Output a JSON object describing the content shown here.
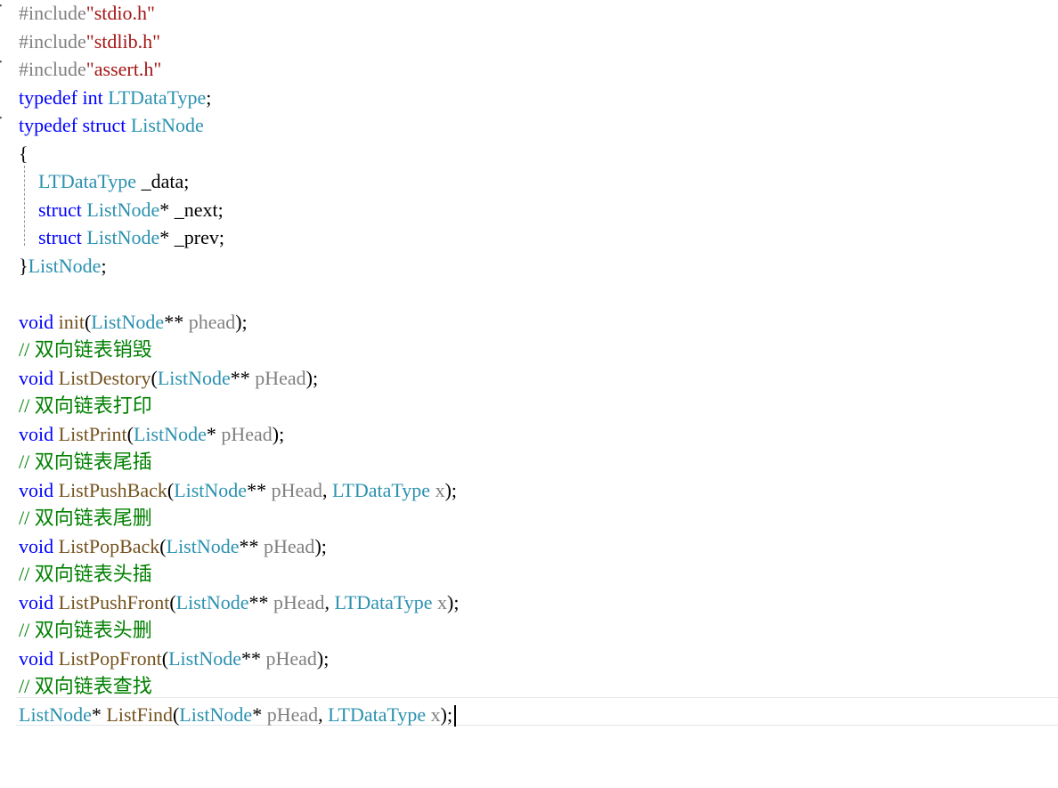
{
  "editor": {
    "lines": [
      {
        "fold": true,
        "tokens": [
          {
            "t": "#include",
            "k": "pp"
          },
          {
            "t": "\"stdio.h\"",
            "k": "str"
          }
        ]
      },
      {
        "fold": false,
        "tokens": [
          {
            "t": "#include",
            "k": "pp"
          },
          {
            "t": "\"stdlib.h\"",
            "k": "str"
          }
        ]
      },
      {
        "fold": true,
        "tokens": [
          {
            "t": "#include",
            "k": "pp"
          },
          {
            "t": "\"assert.h\"",
            "k": "str"
          }
        ]
      },
      {
        "fold": false,
        "tokens": [
          {
            "t": "typedef",
            "k": "kw"
          },
          {
            "t": " ",
            "k": "plain"
          },
          {
            "t": "int",
            "k": "kw"
          },
          {
            "t": " ",
            "k": "plain"
          },
          {
            "t": "LTDataType",
            "k": "type"
          },
          {
            "t": ";",
            "k": "plain"
          }
        ]
      },
      {
        "fold": true,
        "tokens": [
          {
            "t": "typedef",
            "k": "kw"
          },
          {
            "t": " ",
            "k": "plain"
          },
          {
            "t": "struct",
            "k": "kw"
          },
          {
            "t": " ",
            "k": "plain"
          },
          {
            "t": "ListNode",
            "k": "type"
          }
        ]
      },
      {
        "fold": false,
        "tokens": [
          {
            "t": "{",
            "k": "plain"
          }
        ]
      },
      {
        "fold": false,
        "tokens": [
          {
            "t": "    ",
            "k": "plain"
          },
          {
            "t": "LTDataType",
            "k": "type"
          },
          {
            "t": " _data;",
            "k": "plain"
          }
        ]
      },
      {
        "fold": false,
        "tokens": [
          {
            "t": "    ",
            "k": "plain"
          },
          {
            "t": "struct",
            "k": "kw"
          },
          {
            "t": " ",
            "k": "plain"
          },
          {
            "t": "ListNode",
            "k": "type"
          },
          {
            "t": "* _next;",
            "k": "plain"
          }
        ]
      },
      {
        "fold": false,
        "tokens": [
          {
            "t": "    ",
            "k": "plain"
          },
          {
            "t": "struct",
            "k": "kw"
          },
          {
            "t": " ",
            "k": "plain"
          },
          {
            "t": "ListNode",
            "k": "type"
          },
          {
            "t": "* _prev;",
            "k": "plain"
          }
        ]
      },
      {
        "fold": false,
        "tokens": [
          {
            "t": "}",
            "k": "plain"
          },
          {
            "t": "ListNode",
            "k": "type"
          },
          {
            "t": ";",
            "k": "plain"
          }
        ]
      },
      {
        "fold": false,
        "tokens": []
      },
      {
        "fold": false,
        "tokens": [
          {
            "t": "void",
            "k": "kw"
          },
          {
            "t": " ",
            "k": "plain"
          },
          {
            "t": "init",
            "k": "func"
          },
          {
            "t": "(",
            "k": "plain"
          },
          {
            "t": "ListNode",
            "k": "type"
          },
          {
            "t": "** ",
            "k": "plain"
          },
          {
            "t": "phead",
            "k": "param"
          },
          {
            "t": ");",
            "k": "plain"
          }
        ]
      },
      {
        "fold": false,
        "tokens": [
          {
            "t": "// 双向链表销毁",
            "k": "comment"
          }
        ]
      },
      {
        "fold": false,
        "tokens": [
          {
            "t": "void",
            "k": "kw"
          },
          {
            "t": " ",
            "k": "plain"
          },
          {
            "t": "ListDestory",
            "k": "func"
          },
          {
            "t": "(",
            "k": "plain"
          },
          {
            "t": "ListNode",
            "k": "type"
          },
          {
            "t": "** ",
            "k": "plain"
          },
          {
            "t": "pHead",
            "k": "param"
          },
          {
            "t": ");",
            "k": "plain"
          }
        ]
      },
      {
        "fold": false,
        "tokens": [
          {
            "t": "// 双向链表打印",
            "k": "comment"
          }
        ]
      },
      {
        "fold": false,
        "tokens": [
          {
            "t": "void",
            "k": "kw"
          },
          {
            "t": " ",
            "k": "plain"
          },
          {
            "t": "ListPrint",
            "k": "func"
          },
          {
            "t": "(",
            "k": "plain"
          },
          {
            "t": "ListNode",
            "k": "type"
          },
          {
            "t": "* ",
            "k": "plain"
          },
          {
            "t": "pHead",
            "k": "param"
          },
          {
            "t": ");",
            "k": "plain"
          }
        ]
      },
      {
        "fold": false,
        "tokens": [
          {
            "t": "// 双向链表尾插",
            "k": "comment"
          }
        ]
      },
      {
        "fold": false,
        "tokens": [
          {
            "t": "void",
            "k": "kw"
          },
          {
            "t": " ",
            "k": "plain"
          },
          {
            "t": "ListPushBack",
            "k": "func"
          },
          {
            "t": "(",
            "k": "plain"
          },
          {
            "t": "ListNode",
            "k": "type"
          },
          {
            "t": "** ",
            "k": "plain"
          },
          {
            "t": "pHead",
            "k": "param"
          },
          {
            "t": ", ",
            "k": "plain"
          },
          {
            "t": "LTDataType",
            "k": "type"
          },
          {
            "t": " ",
            "k": "plain"
          },
          {
            "t": "x",
            "k": "param"
          },
          {
            "t": ");",
            "k": "plain"
          }
        ]
      },
      {
        "fold": false,
        "tokens": [
          {
            "t": "// 双向链表尾删",
            "k": "comment"
          }
        ]
      },
      {
        "fold": false,
        "tokens": [
          {
            "t": "void",
            "k": "kw"
          },
          {
            "t": " ",
            "k": "plain"
          },
          {
            "t": "ListPopBack",
            "k": "func"
          },
          {
            "t": "(",
            "k": "plain"
          },
          {
            "t": "ListNode",
            "k": "type"
          },
          {
            "t": "** ",
            "k": "plain"
          },
          {
            "t": "pHead",
            "k": "param"
          },
          {
            "t": ");",
            "k": "plain"
          }
        ]
      },
      {
        "fold": false,
        "tokens": [
          {
            "t": "// 双向链表头插",
            "k": "comment"
          }
        ]
      },
      {
        "fold": false,
        "tokens": [
          {
            "t": "void",
            "k": "kw"
          },
          {
            "t": " ",
            "k": "plain"
          },
          {
            "t": "ListPushFront",
            "k": "func"
          },
          {
            "t": "(",
            "k": "plain"
          },
          {
            "t": "ListNode",
            "k": "type"
          },
          {
            "t": "** ",
            "k": "plain"
          },
          {
            "t": "pHead",
            "k": "param"
          },
          {
            "t": ", ",
            "k": "plain"
          },
          {
            "t": "LTDataType",
            "k": "type"
          },
          {
            "t": " ",
            "k": "plain"
          },
          {
            "t": "x",
            "k": "param"
          },
          {
            "t": ");",
            "k": "plain"
          }
        ]
      },
      {
        "fold": false,
        "tokens": [
          {
            "t": "// 双向链表头删",
            "k": "comment"
          }
        ]
      },
      {
        "fold": false,
        "tokens": [
          {
            "t": "void",
            "k": "kw"
          },
          {
            "t": " ",
            "k": "plain"
          },
          {
            "t": "ListPopFront",
            "k": "func"
          },
          {
            "t": "(",
            "k": "plain"
          },
          {
            "t": "ListNode",
            "k": "type"
          },
          {
            "t": "** ",
            "k": "plain"
          },
          {
            "t": "pHead",
            "k": "param"
          },
          {
            "t": ");",
            "k": "plain"
          }
        ]
      },
      {
        "fold": false,
        "tokens": [
          {
            "t": "// 双向链表查找",
            "k": "comment"
          }
        ]
      },
      {
        "fold": false,
        "current": true,
        "tokens": [
          {
            "t": "ListNode",
            "k": "type"
          },
          {
            "t": "* ",
            "k": "plain"
          },
          {
            "t": "ListFind",
            "k": "func"
          },
          {
            "t": "(",
            "k": "plain"
          },
          {
            "t": "ListNode",
            "k": "type"
          },
          {
            "t": "* ",
            "k": "plain"
          },
          {
            "t": "pHead",
            "k": "param"
          },
          {
            "t": ", ",
            "k": "plain"
          },
          {
            "t": "LTDataType",
            "k": "type"
          },
          {
            "t": " ",
            "k": "plain"
          },
          {
            "t": "x",
            "k": "param"
          },
          {
            "t": ");",
            "k": "plain"
          }
        ]
      }
    ]
  },
  "colors": {
    "pp": "#808080",
    "str": "#a31515",
    "kw": "#0000ff",
    "type": "#2b91af",
    "func": "#74531f",
    "param": "#808080",
    "comment": "#008000",
    "plain": "#000000"
  }
}
